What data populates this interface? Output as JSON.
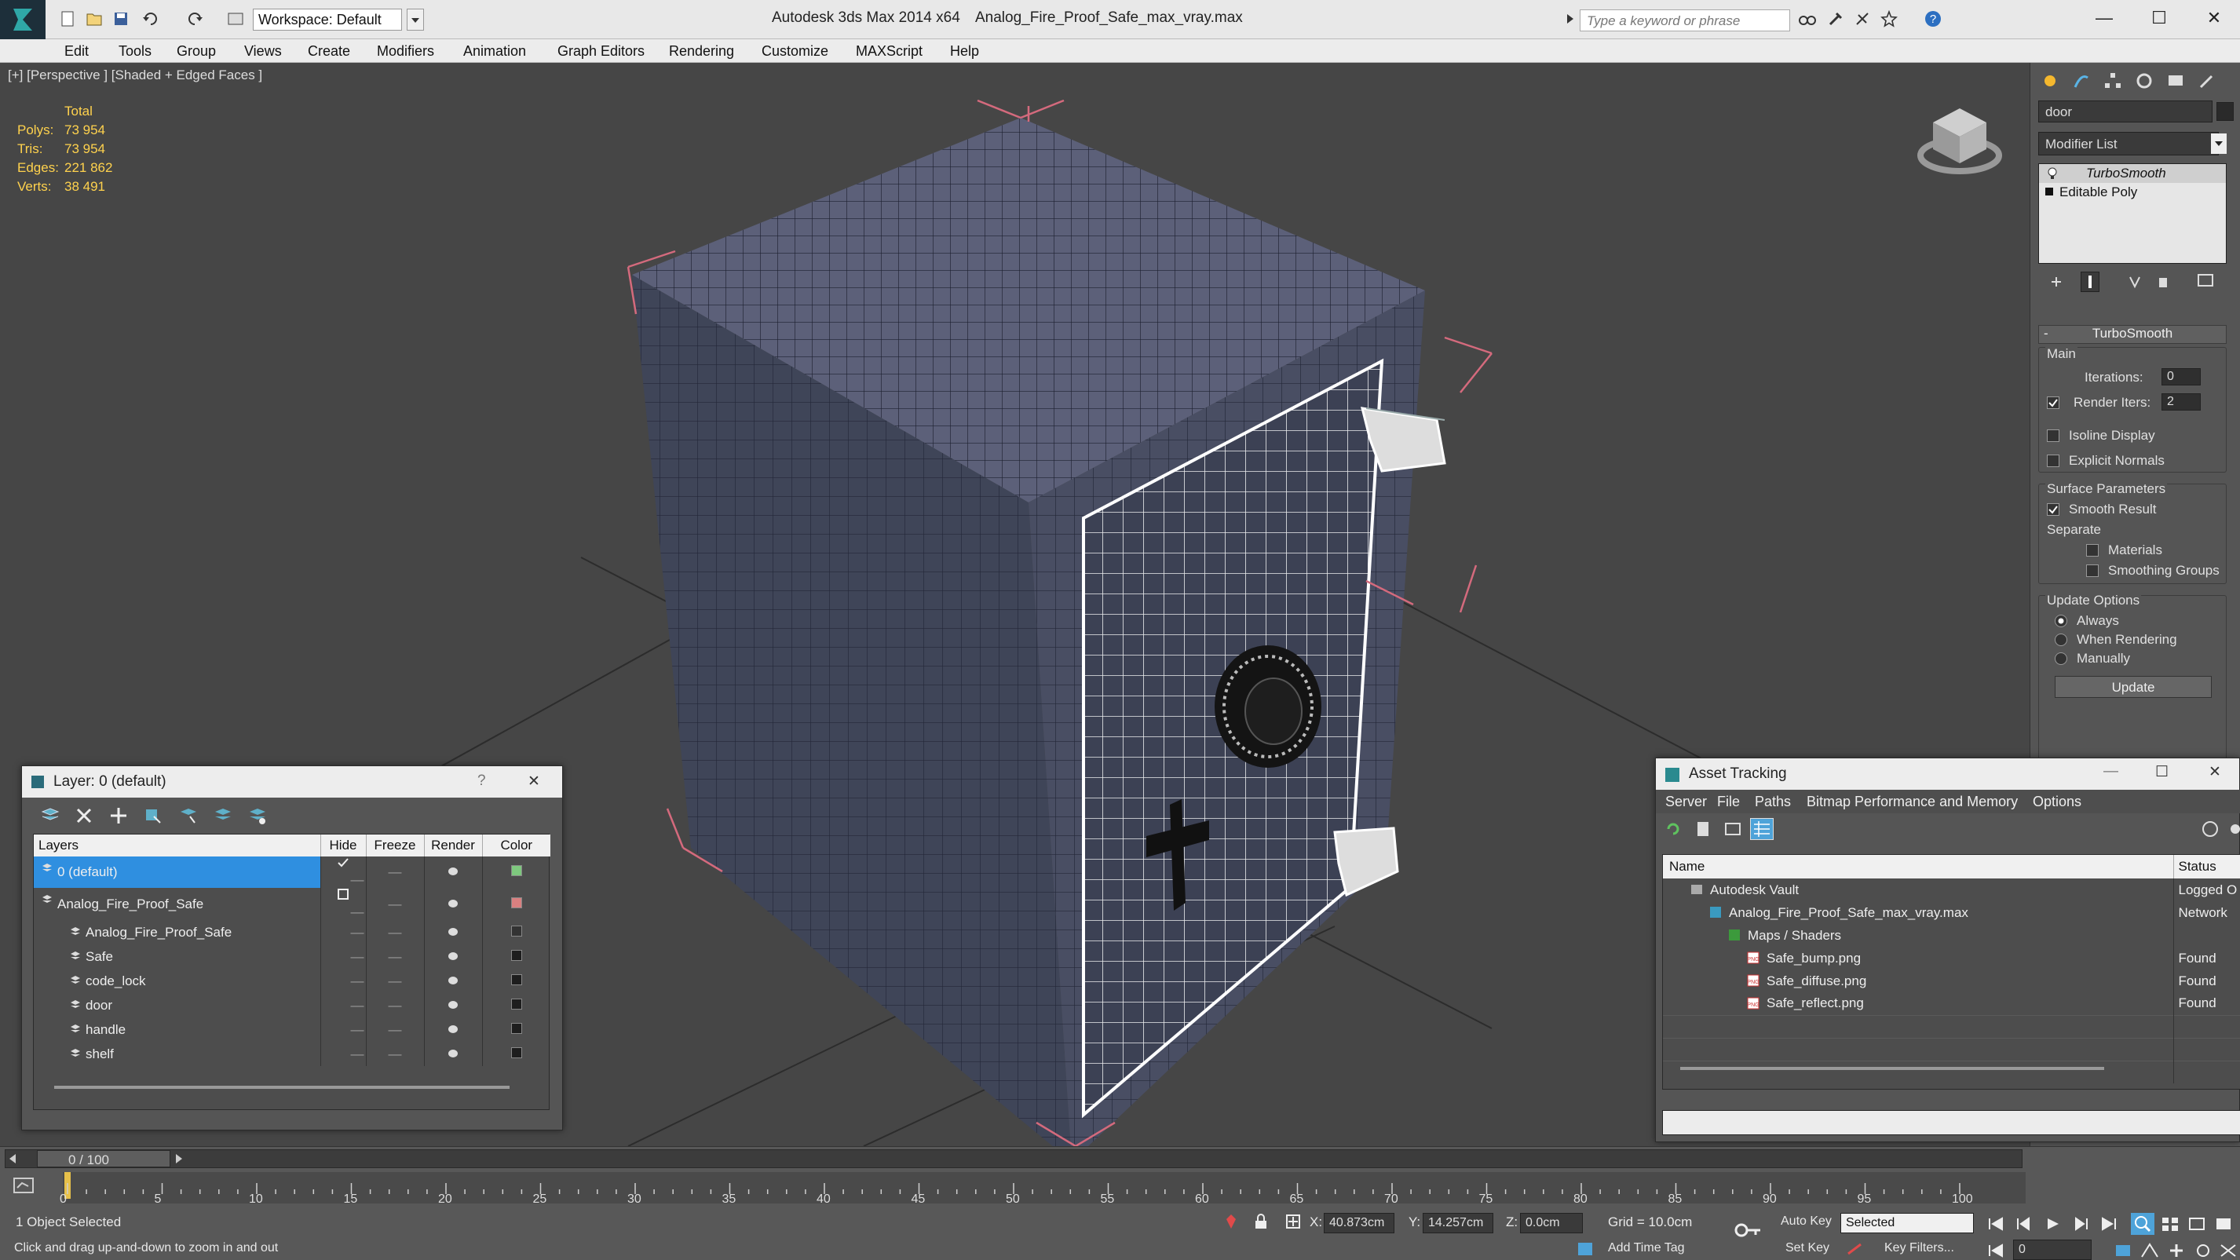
{
  "window": {
    "app_title": "Autodesk 3ds Max  2014 x64",
    "file_title": "Analog_Fire_Proof_Safe_max_vray.max",
    "workspace_label": "Workspace: Default",
    "search_placeholder": "Type a keyword or phrase",
    "min": "—",
    "max": "☐",
    "close": "✕"
  },
  "menu": [
    "Edit",
    "Tools",
    "Group",
    "Views",
    "Create",
    "Modifiers",
    "Animation",
    "Graph Editors",
    "Rendering",
    "Customize",
    "MAXScript",
    "Help"
  ],
  "viewport": {
    "label": "[+] [Perspective ] [Shaded + Edged Faces ]",
    "stats": {
      "header": "Total",
      "rows": [
        {
          "k": "Polys:",
          "v": "73 954"
        },
        {
          "k": "Tris:",
          "v": "73 954"
        },
        {
          "k": "Edges:",
          "v": "221 862"
        },
        {
          "k": "Verts:",
          "v": "38 491"
        }
      ]
    }
  },
  "command_panel": {
    "object_name": "door",
    "modifier_list": "Modifier List",
    "stack": [
      "TurboSmooth",
      "Editable Poly"
    ],
    "turbosmooth": {
      "title": "TurboSmooth",
      "main": "Main",
      "iterations_label": "Iterations:",
      "iterations": "0",
      "render_iters_label": "Render Iters:",
      "render_iters": "2",
      "isoline": "Isoline Display",
      "explicit": "Explicit Normals",
      "surface": "Surface Parameters",
      "smooth_result": "Smooth Result",
      "separate": "Separate",
      "materials": "Materials",
      "smoothing_groups": "Smoothing Groups",
      "update_options": "Update Options",
      "always": "Always",
      "when_rendering": "When Rendering",
      "manually": "Manually",
      "update": "Update"
    }
  },
  "layer_dialog": {
    "title": "Layer: 0 (default)",
    "help": "?",
    "close": "✕",
    "headers": [
      "Layers",
      "Hide",
      "Freeze",
      "Render",
      "Color"
    ],
    "rows": [
      {
        "name": "0 (default)",
        "indent": 0,
        "selected": true,
        "color": "#7ec87e"
      },
      {
        "name": "Analog_Fire_Proof_Safe",
        "indent": 0,
        "selected": false,
        "color": "#d98080"
      },
      {
        "name": "Analog_Fire_Proof_Safe",
        "indent": 1,
        "selected": false,
        "color": "#333333"
      },
      {
        "name": "Safe",
        "indent": 1,
        "selected": false,
        "color": "#1e1e1e"
      },
      {
        "name": "code_lock",
        "indent": 1,
        "selected": false,
        "color": "#1e1e1e"
      },
      {
        "name": "door",
        "indent": 1,
        "selected": false,
        "color": "#1e1e1e"
      },
      {
        "name": "handle",
        "indent": 1,
        "selected": false,
        "color": "#1e1e1e"
      },
      {
        "name": "shelf",
        "indent": 1,
        "selected": false,
        "color": "#1e1e1e"
      }
    ]
  },
  "asset_dialog": {
    "title": "Asset Tracking",
    "menu": [
      "Server",
      "File",
      "Paths",
      "Bitmap Performance and Memory",
      "Options"
    ],
    "headers": [
      "Name",
      "Status"
    ],
    "rows": [
      {
        "name": "Autodesk Vault",
        "status": "Logged O",
        "indent": 1,
        "icon": "vault"
      },
      {
        "name": "Analog_Fire_Proof_Safe_max_vray.max",
        "status": "Network",
        "indent": 2,
        "icon": "max"
      },
      {
        "name": "Maps / Shaders",
        "status": "",
        "indent": 3,
        "icon": "maps"
      },
      {
        "name": "Safe_bump.png",
        "status": "Found",
        "indent": 4,
        "icon": "png"
      },
      {
        "name": "Safe_diffuse.png",
        "status": "Found",
        "indent": 4,
        "icon": "png"
      },
      {
        "name": "Safe_reflect.png",
        "status": "Found",
        "indent": 4,
        "icon": "png"
      }
    ]
  },
  "timeline": {
    "frame": "0 / 100",
    "ticks": [
      "0",
      "5",
      "10",
      "15",
      "20",
      "25",
      "30",
      "35",
      "40",
      "45",
      "50",
      "55",
      "60",
      "65",
      "70",
      "75",
      "80",
      "85",
      "90",
      "95",
      "100"
    ]
  },
  "status": {
    "selection": "1 Object Selected",
    "prompt": "Click and drag up-and-down to zoom in and out",
    "x_label": "X:",
    "x": "40.873cm",
    "y_label": "Y:",
    "y": "14.257cm",
    "z_label": "Z:",
    "z": "0.0cm",
    "grid": "Grid = 10.0cm",
    "add_time_tag": "Add Time Tag",
    "auto_key": "Auto Key",
    "set_key": "Set Key",
    "selected": "Selected",
    "key_filters": "Key Filters...",
    "frame_field": "0"
  }
}
